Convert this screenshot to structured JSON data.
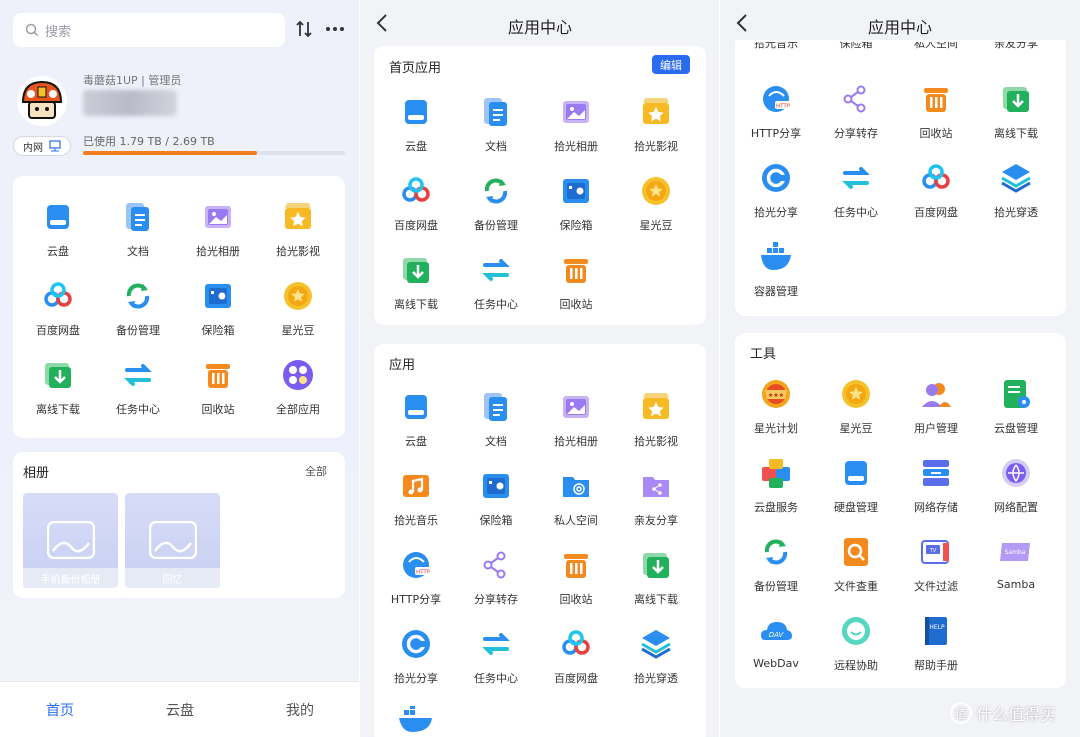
{
  "home": {
    "search_placeholder": "搜索",
    "user_name": "毒蘑菇1UP | 管理员",
    "lan_label": "内网",
    "storage_text": "已使用 1.79 TB / 2.69 TB",
    "storage_used_fraction": 0.665,
    "apps": [
      {
        "label": "云盘",
        "icon": "cloud-drive-icon"
      },
      {
        "label": "文档",
        "icon": "document-icon"
      },
      {
        "label": "拾光相册",
        "icon": "photo-album-icon"
      },
      {
        "label": "拾光影视",
        "icon": "video-icon"
      },
      {
        "label": "百度网盘",
        "icon": "baidu-netdisk-icon"
      },
      {
        "label": "备份管理",
        "icon": "backup-icon"
      },
      {
        "label": "保险箱",
        "icon": "safe-icon"
      },
      {
        "label": "星光豆",
        "icon": "star-bean-icon"
      },
      {
        "label": "离线下载",
        "icon": "offline-download-icon"
      },
      {
        "label": "任务中心",
        "icon": "task-center-icon"
      },
      {
        "label": "回收站",
        "icon": "recycle-bin-icon"
      },
      {
        "label": "全部应用",
        "icon": "all-apps-icon"
      }
    ],
    "album_title": "相册",
    "album_all": "全部",
    "albums": [
      {
        "caption": "手机备份相册"
      },
      {
        "caption": "回忆"
      }
    ],
    "nav": [
      {
        "label": "首页",
        "active": true
      },
      {
        "label": "云盘",
        "active": false
      },
      {
        "label": "我的",
        "active": false
      }
    ]
  },
  "app_center": {
    "title": "应用中心",
    "home_apps_title": "首页应用",
    "edit_label": "编辑",
    "home_apps": [
      {
        "label": "云盘",
        "icon": "cloud-drive-icon"
      },
      {
        "label": "文档",
        "icon": "document-icon"
      },
      {
        "label": "拾光相册",
        "icon": "photo-album-icon"
      },
      {
        "label": "拾光影视",
        "icon": "video-icon"
      },
      {
        "label": "百度网盘",
        "icon": "baidu-netdisk-icon"
      },
      {
        "label": "备份管理",
        "icon": "backup-icon"
      },
      {
        "label": "保险箱",
        "icon": "safe-icon"
      },
      {
        "label": "星光豆",
        "icon": "star-bean-icon"
      },
      {
        "label": "离线下载",
        "icon": "offline-download-icon"
      },
      {
        "label": "任务中心",
        "icon": "task-center-icon"
      },
      {
        "label": "回收站",
        "icon": "recycle-bin-icon"
      }
    ],
    "apps_title": "应用",
    "apps": [
      {
        "label": "云盘",
        "icon": "cloud-drive-icon"
      },
      {
        "label": "文档",
        "icon": "document-icon"
      },
      {
        "label": "拾光相册",
        "icon": "photo-album-icon"
      },
      {
        "label": "拾光影视",
        "icon": "video-icon"
      },
      {
        "label": "拾光音乐",
        "icon": "music-icon"
      },
      {
        "label": "保险箱",
        "icon": "safe-icon"
      },
      {
        "label": "私人空间",
        "icon": "private-space-icon"
      },
      {
        "label": "亲友分享",
        "icon": "family-share-icon"
      },
      {
        "label": "HTTP分享",
        "icon": "http-share-icon"
      },
      {
        "label": "分享转存",
        "icon": "share-transfer-icon"
      },
      {
        "label": "回收站",
        "icon": "recycle-bin-icon"
      },
      {
        "label": "离线下载",
        "icon": "offline-download-icon"
      },
      {
        "label": "拾光分享",
        "icon": "shiguang-share-icon"
      },
      {
        "label": "任务中心",
        "icon": "task-center-icon"
      },
      {
        "label": "百度网盘",
        "icon": "baidu-netdisk-icon"
      },
      {
        "label": "拾光穿透",
        "icon": "penetration-icon"
      }
    ]
  },
  "app_center_scrolled": {
    "title": "应用中心",
    "top_partial_labels": [
      "拾光音乐",
      "保险箱",
      "私人空间",
      "亲友分享"
    ],
    "apps": [
      {
        "label": "HTTP分享",
        "icon": "http-share-icon"
      },
      {
        "label": "分享转存",
        "icon": "share-transfer-icon"
      },
      {
        "label": "回收站",
        "icon": "recycle-bin-icon"
      },
      {
        "label": "离线下载",
        "icon": "offline-download-icon"
      },
      {
        "label": "拾光分享",
        "icon": "shiguang-share-icon"
      },
      {
        "label": "任务中心",
        "icon": "task-center-icon"
      },
      {
        "label": "百度网盘",
        "icon": "baidu-netdisk-icon"
      },
      {
        "label": "拾光穿透",
        "icon": "penetration-icon"
      },
      {
        "label": "容器管理",
        "icon": "docker-icon"
      }
    ],
    "tools_title": "工具",
    "tools": [
      {
        "label": "星光计划",
        "icon": "star-plan-icon"
      },
      {
        "label": "星光豆",
        "icon": "star-bean-icon"
      },
      {
        "label": "用户管理",
        "icon": "user-manage-icon"
      },
      {
        "label": "云盘管理",
        "icon": "drive-manage-icon"
      },
      {
        "label": "云盘服务",
        "icon": "drive-service-icon"
      },
      {
        "label": "硬盘管理",
        "icon": "disk-manage-icon"
      },
      {
        "label": "网络存储",
        "icon": "network-storage-icon"
      },
      {
        "label": "网络配置",
        "icon": "network-config-icon"
      },
      {
        "label": "备份管理",
        "icon": "backup-icon"
      },
      {
        "label": "文件查重",
        "icon": "dedupe-icon"
      },
      {
        "label": "文件过滤",
        "icon": "file-filter-icon"
      },
      {
        "label": "Samba",
        "icon": "samba-icon"
      },
      {
        "label": "WebDav",
        "icon": "webdav-icon"
      },
      {
        "label": "远程协助",
        "icon": "remote-assist-icon"
      },
      {
        "label": "帮助手册",
        "icon": "help-manual-icon"
      }
    ]
  },
  "watermark": "什么值得买",
  "colors": {
    "accent": "#2a6cf0",
    "storage": "#f07d1e"
  }
}
